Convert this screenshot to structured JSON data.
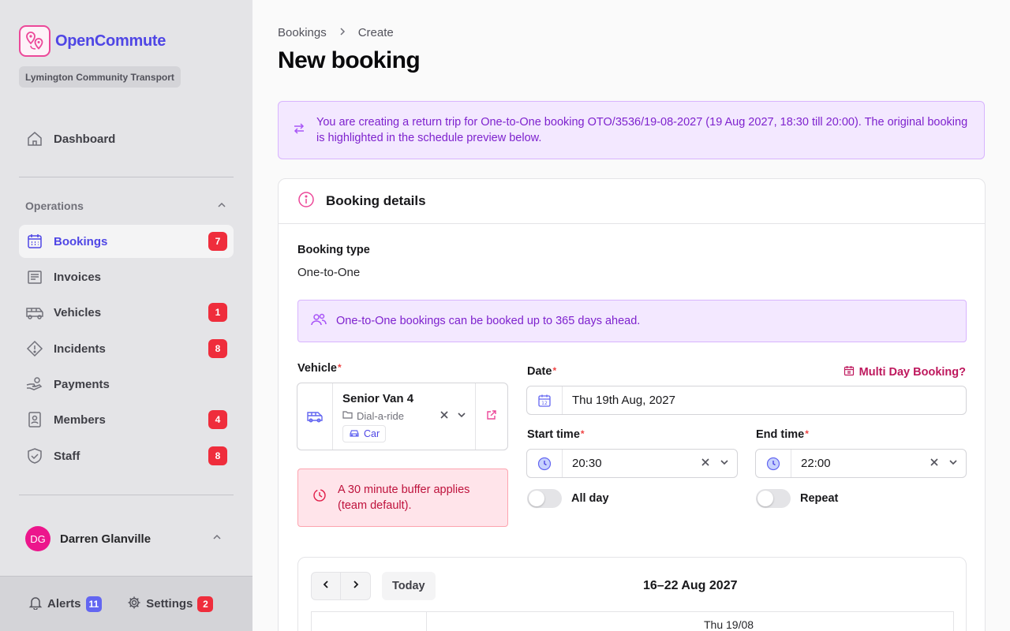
{
  "brand": {
    "name": "OpenCommute",
    "org": "Lymington Community Transport"
  },
  "nav": {
    "dashboard": "Dashboard",
    "section": "Operations",
    "items": [
      {
        "label": "Bookings",
        "badge": "7",
        "icon": "calendar-icon",
        "active": true
      },
      {
        "label": "Invoices",
        "badge": "",
        "icon": "invoice-icon"
      },
      {
        "label": "Vehicles",
        "badge": "1",
        "icon": "bus-icon"
      },
      {
        "label": "Incidents",
        "badge": "8",
        "icon": "warning-icon"
      },
      {
        "label": "Payments",
        "badge": "",
        "icon": "hand-coins-icon"
      },
      {
        "label": "Members",
        "badge": "4",
        "icon": "id-card-icon"
      },
      {
        "label": "Staff",
        "badge": "8",
        "icon": "shield-icon"
      }
    ]
  },
  "user": {
    "initials": "DG",
    "name": "Darren Glanville"
  },
  "footer": {
    "alerts_label": "Alerts",
    "alerts_count": "11",
    "settings_label": "Settings",
    "settings_count": "2"
  },
  "breadcrumb": {
    "parent": "Bookings",
    "current": "Create"
  },
  "page_title": "New booking",
  "return_banner": "You are creating a return trip for One-to-One booking OTO/3536/19-08-2027 (19 Aug 2027, 18:30 till 20:00). The original booking is highlighted in the schedule preview below.",
  "details": {
    "title": "Booking details",
    "type_label": "Booking type",
    "type_value": "One-to-One",
    "info": "One-to-One bookings can be booked up to 365 days ahead.",
    "vehicle_label": "Vehicle",
    "vehicle": {
      "name": "Senior Van 4",
      "group": "Dial-a-ride",
      "kind": "Car"
    },
    "buffer_note": "A 30 minute buffer applies (team default).",
    "date_label": "Date",
    "multi_day": "Multi Day Booking?",
    "date_value": "Thu 19th Aug, 2027",
    "start_label": "Start time",
    "start_value": "20:30",
    "end_label": "End time",
    "end_value": "22:00",
    "all_day_label": "All day",
    "repeat_label": "Repeat"
  },
  "calendar": {
    "today": "Today",
    "range": "16–22 Aug 2027",
    "day": "Thu 19/08"
  },
  "colors": {
    "accent": "#4f46e5",
    "brand_pink": "#ec4899",
    "badge_red": "#ef2d3c",
    "info_bg": "#f3e8ff"
  }
}
